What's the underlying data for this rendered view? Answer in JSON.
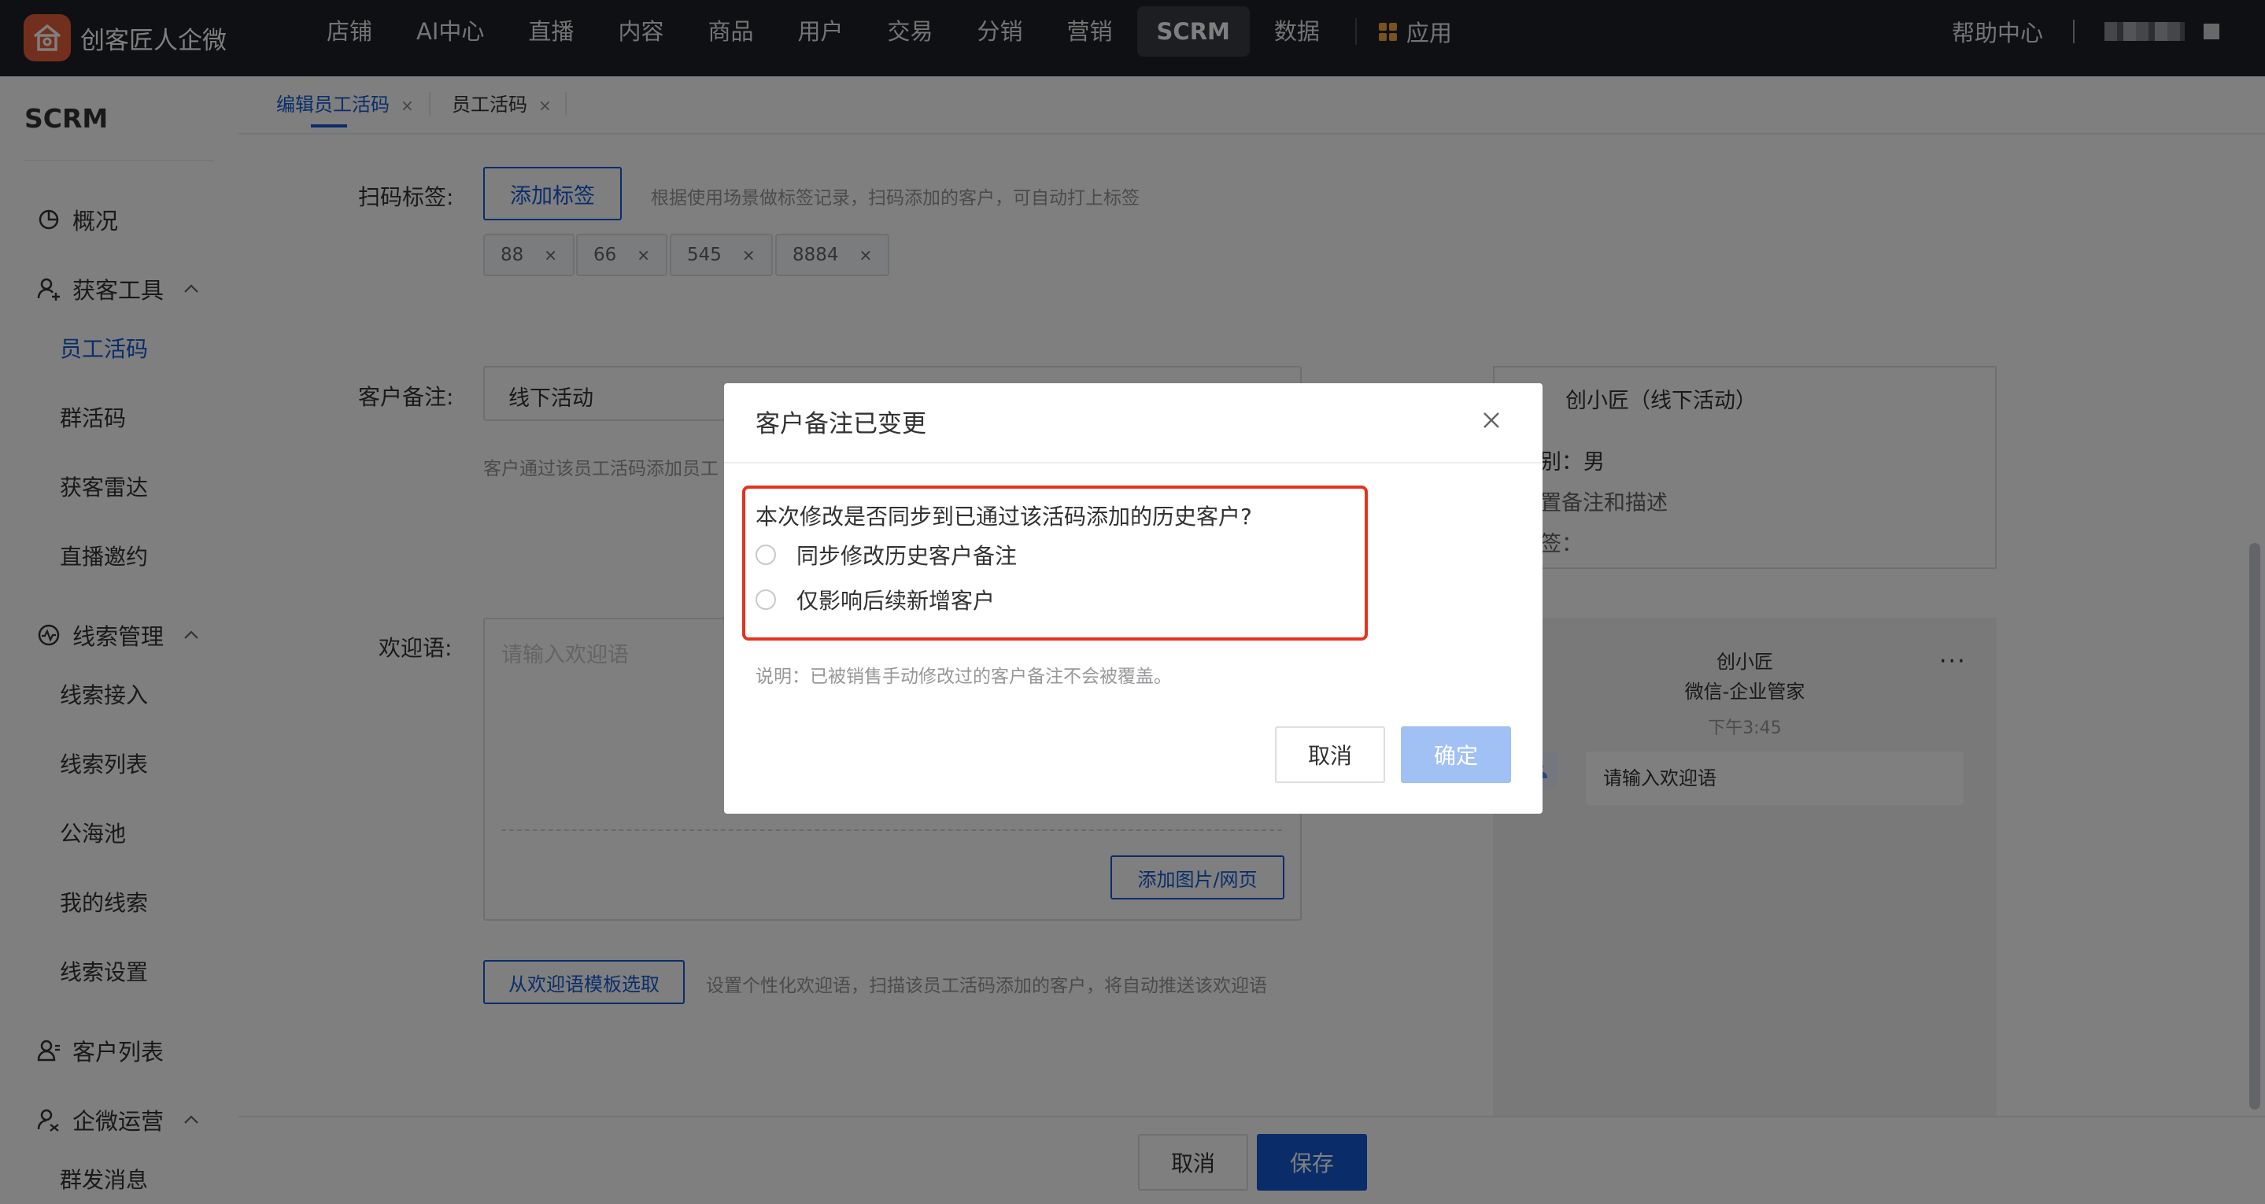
{
  "app": {
    "brand_name": "创客匠人企微",
    "brand_color": "#e45f3b"
  },
  "nav": {
    "items": [
      "店铺",
      "AI中心",
      "直播",
      "内容",
      "商品",
      "用户",
      "交易",
      "分销",
      "营销",
      "SCRM",
      "数据"
    ],
    "active": "SCRM",
    "apps_label": "应用",
    "help_label": "帮助中心"
  },
  "sidebar": {
    "title": "SCRM",
    "groups": {
      "overview": "概况",
      "acquisition": "获客工具",
      "leads": "线索管理",
      "customers": "客户列表",
      "operations": "企微运营"
    },
    "acquisition_items": [
      "员工活码",
      "群活码",
      "获客雷达",
      "直播邀约"
    ],
    "leads_items": [
      "线索接入",
      "线索列表",
      "公海池",
      "我的线索",
      "线索设置"
    ],
    "operations_items": [
      "群发消息"
    ],
    "active_item": "员工活码"
  },
  "tabs": {
    "items": [
      "编辑员工活码",
      "员工活码"
    ],
    "close_glyph": "×"
  },
  "form": {
    "scan_tag_label": "扫码标签:",
    "add_tag_button": "添加标签",
    "scan_tag_hint": "根据使用场景做标签记录，扫码添加的客户，可自动打上标签",
    "tags": [
      "88",
      "66",
      "545",
      "8884"
    ],
    "remark_label": "客户备注:",
    "remark_value": "线下活动",
    "remark_hint": "客户通过该员工活码添加员工",
    "welcome_label": "欢迎语:",
    "welcome_placeholder": "请输入欢迎语",
    "add_media_button": "添加图片/网页",
    "template_button": "从欢迎语模板选取",
    "template_hint": "设置个性化欢迎语，扫描该员工活码添加的客户，将自动推送该欢迎语"
  },
  "preview": {
    "card_name": "创小匠（线下活动）",
    "gender_label": "别：",
    "gender_value": "男",
    "desc_label": "置备注和描述",
    "tag_label": "签：",
    "chat_name": "创小匠",
    "chat_company": "微信-企业管家",
    "chat_time": "下午3:45",
    "chat_more": "···",
    "chat_bubble": "请输入欢迎语"
  },
  "footer": {
    "cancel_label": "取消",
    "save_label": "保存"
  },
  "modal": {
    "title": "客户备注已变更",
    "question": "本次修改是否同步到已通过该活码添加的历史客户?",
    "options": [
      "同步修改历史客户备注",
      "仅影响后续新增客户"
    ],
    "note": "说明：已被销售手动修改过的客户备注不会被覆盖。",
    "cancel_label": "取消",
    "confirm_label": "确定",
    "highlight_color": "#e5331f"
  },
  "colors": {
    "primary": "#155bd4",
    "topbar": "#1f2126",
    "confirm_disabled": "#a1c1f5"
  }
}
